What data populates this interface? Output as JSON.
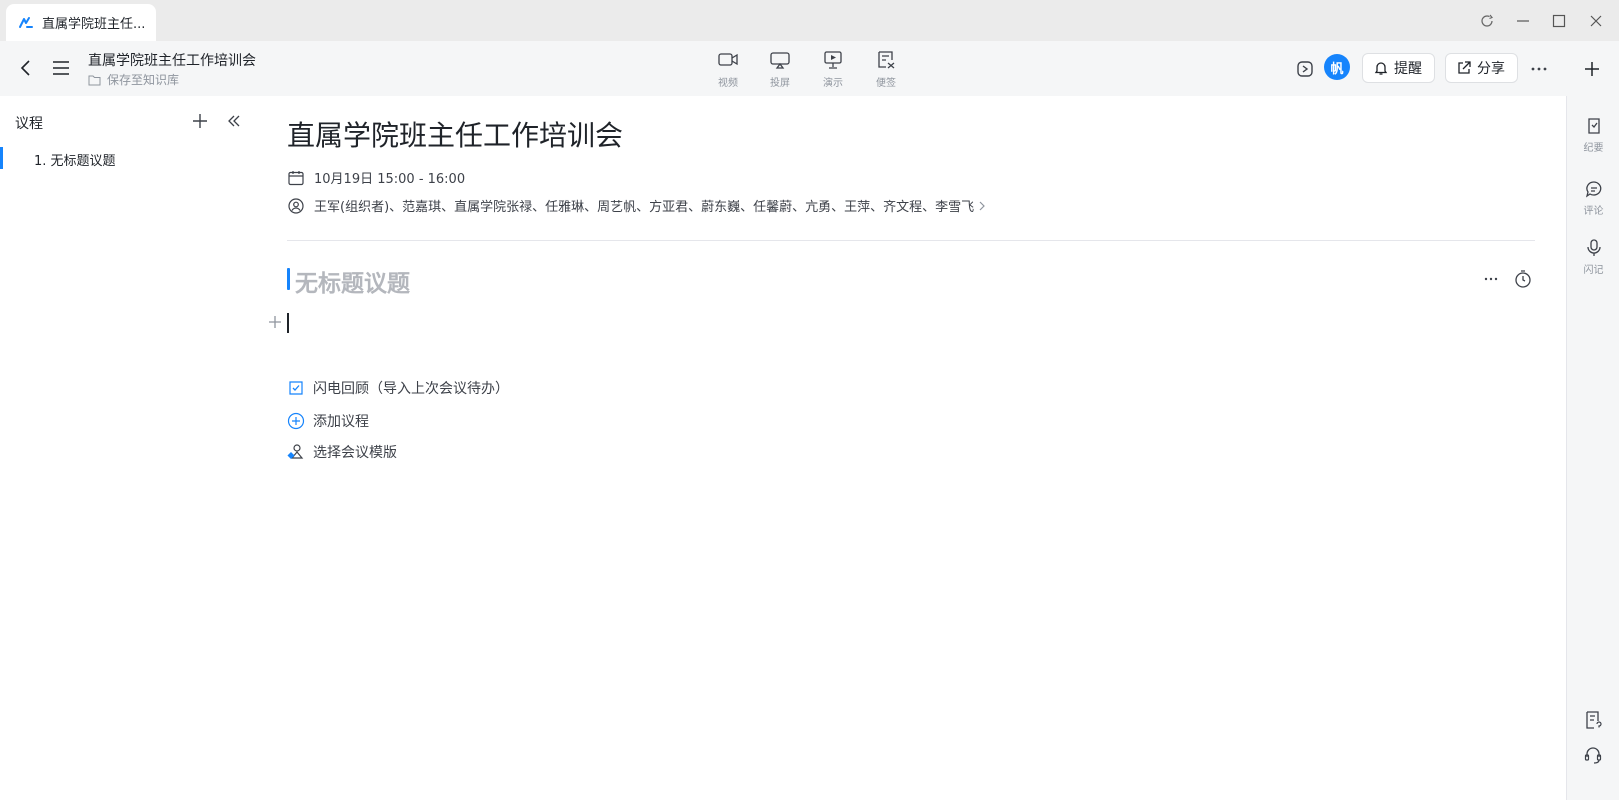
{
  "window": {
    "tab_title": "直属学院班主任...",
    "controls": [
      "refresh-icon",
      "minimize-icon",
      "maximize-icon",
      "close-icon"
    ]
  },
  "toolbar": {
    "doc_title": "直属学院班主任工作培训会",
    "save_location": "保存至知识库",
    "tools": [
      {
        "icon": "video-icon",
        "label": "视频"
      },
      {
        "icon": "cast-icon",
        "label": "投屏"
      },
      {
        "icon": "present-icon",
        "label": "演示"
      },
      {
        "icon": "sticky-note-icon",
        "label": "便签"
      }
    ],
    "avatar_text": "帆",
    "remind_label": "提醒",
    "share_label": "分享",
    "accent_color": "#1684fc"
  },
  "outline": {
    "title": "议程",
    "items": [
      {
        "label": "1. 无标题议题"
      }
    ]
  },
  "meeting": {
    "title": "直属学院班主任工作培训会",
    "time": "10月19日 15:00 - 16:00",
    "participants": "王军(组织者)、范嘉琪、直属学院张禄、任雅琳、周艺帆、方亚君、蔚东巍、任馨蔚、亢勇、王萍、齐文程、李雪飞",
    "topic_title": "无标题议题",
    "actions": [
      {
        "icon": "lightning-review-icon",
        "label": "闪电回顾（导入上次会议待办）"
      },
      {
        "icon": "add-circle-icon",
        "label": "添加议程"
      },
      {
        "icon": "template-icon",
        "label": "选择会议模版"
      }
    ]
  },
  "right_sidebar": {
    "items": [
      {
        "icon": "minutes-icon",
        "label": "纪要"
      },
      {
        "icon": "comment-icon",
        "label": "评论"
      },
      {
        "icon": "mic-icon",
        "label": "闪记"
      }
    ]
  }
}
